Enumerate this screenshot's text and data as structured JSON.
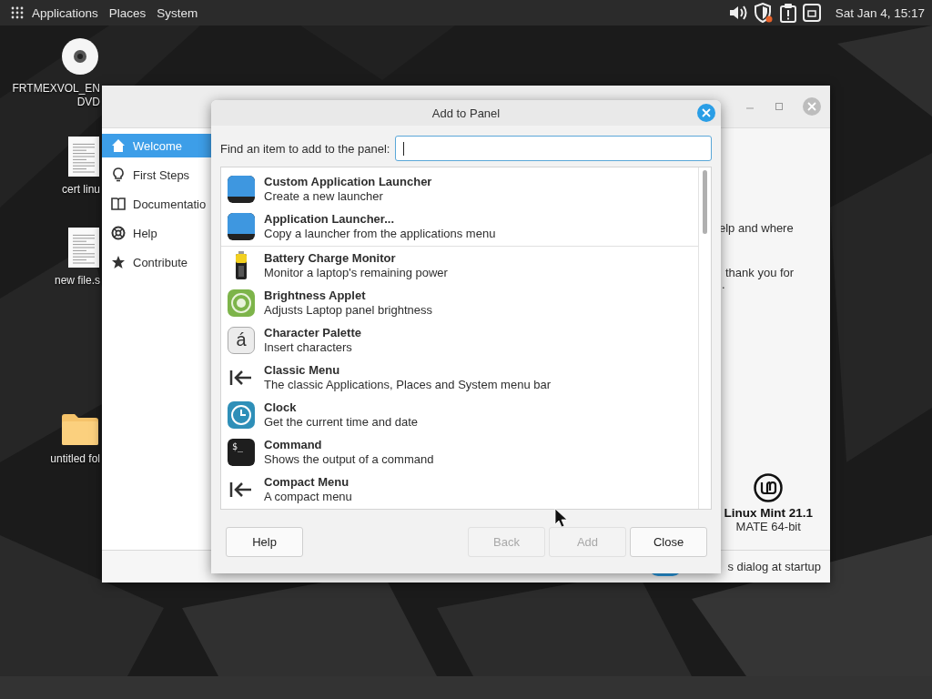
{
  "top_panel": {
    "menus": [
      "Applications",
      "Places",
      "System"
    ],
    "clock": "Sat Jan 4, 15:17"
  },
  "desktop_icons": [
    {
      "kind": "disc",
      "lines": [
        "FRTMEXVOL_EN",
        "DVD"
      ]
    },
    {
      "kind": "document",
      "lines": [
        "cert linu"
      ]
    },
    {
      "kind": "document",
      "lines": [
        "new file.s"
      ]
    },
    {
      "kind": "folder",
      "lines": [
        "untitled fol"
      ]
    }
  ],
  "welcome_window": {
    "sidebar": [
      {
        "label": "Welcome",
        "selected": true
      },
      {
        "label": "First Steps",
        "selected": false
      },
      {
        "label": "Documentatio",
        "selected": false
      },
      {
        "label": "Help",
        "selected": false
      },
      {
        "label": "Contribute",
        "selected": false
      }
    ],
    "text_fragments": [
      "elp and where",
      "thank you for",
      "."
    ],
    "logo": {
      "name": "Linux Mint 21.1",
      "edition": "MATE 64-bit"
    },
    "startup_switch": {
      "on": true
    },
    "startup_text": "s dialog at startup"
  },
  "dialog": {
    "title": "Add to Panel",
    "search_label": "Find an item to add to the panel:",
    "items": [
      {
        "kind": "launcher",
        "name": "Custom Application Launcher",
        "description": "Create a new launcher",
        "divider_below": false
      },
      {
        "kind": "launcher",
        "name": "Application Launcher...",
        "description": "Copy a launcher from the applications menu",
        "divider_below": true
      },
      {
        "kind": "battery",
        "name": "Battery Charge Monitor",
        "description": "Monitor a laptop's remaining power",
        "divider_below": false
      },
      {
        "kind": "brightness",
        "name": "Brightness Applet",
        "description": "Adjusts Laptop panel brightness",
        "divider_below": false
      },
      {
        "kind": "charpalette",
        "icon_text": "á",
        "name": "Character Palette",
        "description": "Insert characters",
        "divider_below": false
      },
      {
        "kind": "menu",
        "name": "Classic Menu",
        "description": "The classic Applications, Places and System menu bar",
        "divider_below": false
      },
      {
        "kind": "clock",
        "name": "Clock",
        "description": "Get the current time and date",
        "divider_below": false
      },
      {
        "kind": "terminal",
        "icon_text": "$_",
        "name": "Command",
        "description": "Shows the output of a command",
        "divider_below": false
      },
      {
        "kind": "menu",
        "name": "Compact Menu",
        "description": "A compact menu",
        "divider_below": false
      }
    ],
    "buttons": [
      {
        "label": "Help",
        "disabled": false
      },
      {
        "label": "Back",
        "disabled": true
      },
      {
        "label": "Add",
        "disabled": true
      },
      {
        "label": "Close",
        "disabled": false
      }
    ]
  }
}
